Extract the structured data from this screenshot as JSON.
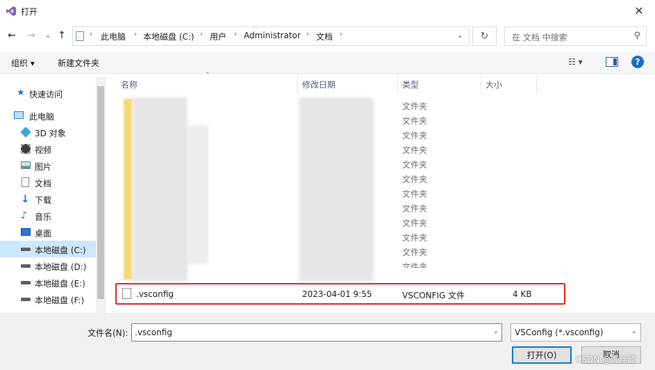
{
  "window": {
    "title": "打开",
    "close_glyph": "✕"
  },
  "nav": {
    "back_glyph": "←",
    "forward_glyph": "→",
    "recent_glyph": "⌄",
    "up_glyph": "↑",
    "breadcrumb": [
      "此电脑",
      "本地磁盘 (C:)",
      "用户",
      "Administrator",
      "文档"
    ],
    "refresh_glyph": "↻",
    "search_placeholder": "在 文档 中搜索"
  },
  "toolbar": {
    "organize": "组织 ▾",
    "new_folder": "新建文件夹",
    "view_glyph": "☷ ▾",
    "help": "?"
  },
  "sidebar": {
    "items": [
      {
        "label": "快速访问",
        "icon": "star-icon"
      },
      {
        "label": "此电脑",
        "icon": "computer-icon"
      },
      {
        "label": "3D 对象",
        "icon": "cube-icon"
      },
      {
        "label": "视频",
        "icon": "video-icon"
      },
      {
        "label": "图片",
        "icon": "picture-icon"
      },
      {
        "label": "文档",
        "icon": "document-icon"
      },
      {
        "label": "下载",
        "icon": "download-icon"
      },
      {
        "label": "音乐",
        "icon": "music-icon"
      },
      {
        "label": "桌面",
        "icon": "desktop-icon"
      },
      {
        "label": "本地磁盘 (C:)",
        "icon": "drive-icon",
        "selected": true
      },
      {
        "label": "本地磁盘 (D:)",
        "icon": "drive-icon"
      },
      {
        "label": "本地磁盘 (E:)",
        "icon": "drive-icon"
      },
      {
        "label": "本地磁盘 (F:)",
        "icon": "drive-icon"
      }
    ]
  },
  "columns": {
    "name": "名称",
    "modified": "修改日期",
    "type": "类型",
    "size": "大小"
  },
  "folder_rows": [
    "文件夹",
    "文件夹",
    "文件夹",
    "文件夹",
    "文件夹",
    "文件夹",
    "文件夹",
    "文件夹",
    "文件夹",
    "文件夹",
    "文件夹",
    "文件夹"
  ],
  "file": {
    "name": ".vsconfig",
    "modified": "2023-04-01 9:55",
    "type": "VSCONFIG 文件",
    "size": "4 KB"
  },
  "bottom": {
    "filename_label": "文件名(N):",
    "filename_value": ".vsconfig",
    "filter_value": "VSConfig (*.vsconfig)",
    "open": "打开(O)",
    "cancel": "取消"
  },
  "watermark": "CSDN @青丝藏",
  "colors": {
    "accent": "#0078d7",
    "highlight": "#e11f1f",
    "selected": "#cce8ff"
  }
}
